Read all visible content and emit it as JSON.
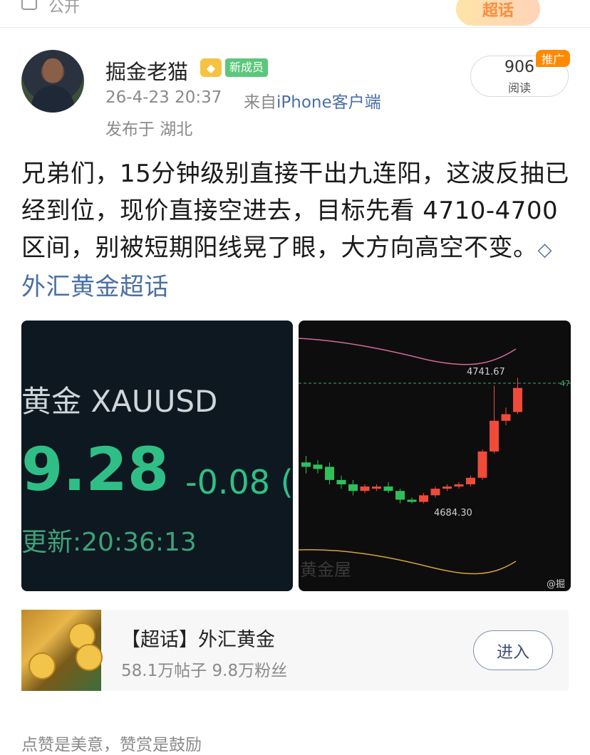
{
  "top": {
    "visibility": "公开",
    "chaohua_badge": "超话"
  },
  "post": {
    "username": "掘金老猫",
    "new_member_badge": "新成员",
    "timestamp": "26-4-23 20:37",
    "source_prefix": "来自",
    "source_device": "iPhone客户端",
    "location": "发布于 湖北",
    "read_count": "906",
    "read_label": "阅读",
    "promo_tag": "推广",
    "body": "兄弟们，15分钟级别直接干出九连阳，这波反抽已经到位，现价直接空进去，目标先看 4710-4700区间，别被短期阳线晃了眼，大方向高空不变。",
    "topic_link": "外汇黄金超话"
  },
  "quote_image": {
    "title": "黄金  XAUUSD",
    "price": "9.28",
    "change": "-0.08 (",
    "update_time": "更新:20:36:13"
  },
  "chart_image": {
    "high_label": "4741.67",
    "low_label": "4684.30",
    "watermark": "黄金屋",
    "corner_label": "@掘",
    "right_edge_label": "47"
  },
  "chart_data": {
    "type": "candlestick",
    "annotations": [
      "4741.67",
      "4684.30"
    ],
    "candles": [
      {
        "o": 4703,
        "c": 4701,
        "h": 4706,
        "l": 4698,
        "color": "green"
      },
      {
        "o": 4702,
        "c": 4700,
        "h": 4704,
        "l": 4698,
        "color": "green"
      },
      {
        "o": 4701,
        "c": 4695,
        "h": 4703,
        "l": 4693,
        "color": "green"
      },
      {
        "o": 4695,
        "c": 4693,
        "h": 4697,
        "l": 4691,
        "color": "green"
      },
      {
        "o": 4693,
        "c": 4690,
        "h": 4695,
        "l": 4688,
        "color": "green"
      },
      {
        "o": 4690,
        "c": 4692,
        "h": 4693,
        "l": 4689,
        "color": "red"
      },
      {
        "o": 4692,
        "c": 4691,
        "h": 4693,
        "l": 4690,
        "color": "red"
      },
      {
        "o": 4692,
        "c": 4690,
        "h": 4694,
        "l": 4689,
        "color": "green"
      },
      {
        "o": 4690,
        "c": 4686,
        "h": 4691,
        "l": 4684.3,
        "color": "green"
      },
      {
        "o": 4686,
        "c": 4685,
        "h": 4687,
        "l": 4684.3,
        "color": "green"
      },
      {
        "o": 4685,
        "c": 4688,
        "h": 4689,
        "l": 4684.3,
        "color": "red"
      },
      {
        "o": 4688,
        "c": 4691,
        "h": 4692,
        "l": 4687,
        "color": "red"
      },
      {
        "o": 4691,
        "c": 4692,
        "h": 4693,
        "l": 4690,
        "color": "red"
      },
      {
        "o": 4692,
        "c": 4693,
        "h": 4694,
        "l": 4691,
        "color": "red"
      },
      {
        "o": 4693,
        "c": 4696,
        "h": 4697,
        "l": 4692,
        "color": "red"
      },
      {
        "o": 4696,
        "c": 4708,
        "h": 4709,
        "l": 4695,
        "color": "red"
      },
      {
        "o": 4708,
        "c": 4722,
        "h": 4738,
        "l": 4707,
        "color": "red"
      },
      {
        "o": 4722,
        "c": 4725,
        "h": 4728,
        "l": 4720,
        "color": "red"
      },
      {
        "o": 4726,
        "c": 4737,
        "h": 4741.67,
        "l": 4725,
        "color": "red"
      }
    ]
  },
  "topic_card": {
    "name": "【超话】外汇黄金",
    "stats": "58.1万帖子 9.8万粉丝",
    "enter_button": "进入"
  },
  "footer": {
    "text": "点赞是美意，赞赏是鼓励"
  },
  "colors": {
    "link": "#4a6fa5",
    "up": "#f04a3a",
    "down": "#2fbf5a",
    "quote_green": "#2fbf86"
  }
}
